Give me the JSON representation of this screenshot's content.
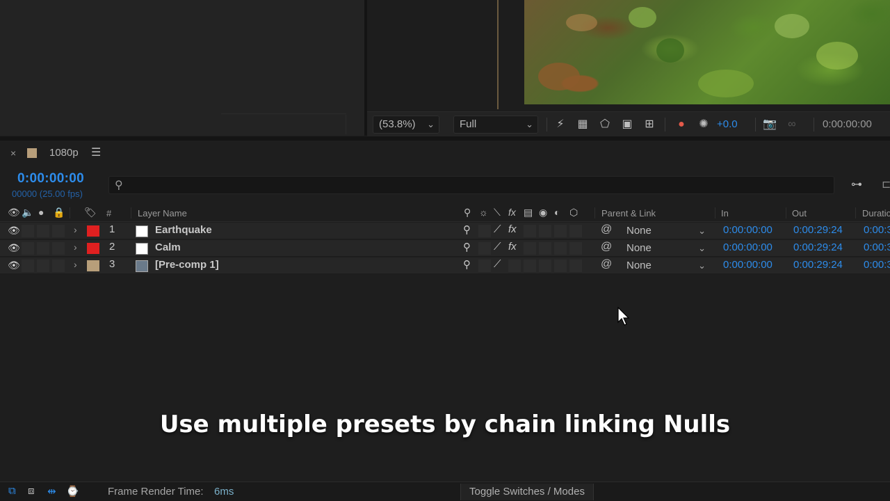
{
  "viewer": {
    "zoom": "(53.8%)",
    "resolution": "Full",
    "exposure": "+0.0",
    "time": "0:00:00:00",
    "icons": [
      "fast-preview-icon",
      "transparency-grid-icon",
      "mask-visibility-icon",
      "region-of-interest-icon",
      "safe-margins-icon",
      "channel-icon",
      "reset-exposure-icon",
      "snapshot-icon",
      "show-snapshot-icon"
    ]
  },
  "timeline": {
    "close": "×",
    "comp_name": "1080p",
    "menu": "☰",
    "timecode": "0:00:00:00",
    "frames": "00000 (25.00 fps)",
    "columns": {
      "hash": "#",
      "layer_name": "Layer Name",
      "parent_link": "Parent & Link",
      "in": "In",
      "out": "Out",
      "duration": "Duratio"
    },
    "layers": [
      {
        "num": "1",
        "name": "Earthquake",
        "label_color": "#e02020",
        "parent": "None",
        "in": "0:00:00:00",
        "out": "0:00:29:24",
        "dur": "0:00:3",
        "fx": true,
        "source": "solid"
      },
      {
        "num": "2",
        "name": "Calm",
        "label_color": "#e02020",
        "parent": "None",
        "in": "0:00:00:00",
        "out": "0:00:29:24",
        "dur": "0:00:3",
        "fx": true,
        "source": "solid"
      },
      {
        "num": "3",
        "name": "[Pre-comp 1]",
        "label_color": "#b79e7a",
        "parent": "None",
        "in": "0:00:00:00",
        "out": "0:00:29:24",
        "dur": "0:00:3",
        "fx": false,
        "source": "composition"
      }
    ]
  },
  "caption": "Use multiple presets by chain linking Nulls",
  "status": {
    "render_label": "Frame Render Time:",
    "render_value": "6ms",
    "toggle": "Toggle Switches / Modes"
  },
  "colors": {
    "accent": "#2d8ceb",
    "panel": "#1e1e1e",
    "row": "#262626"
  }
}
